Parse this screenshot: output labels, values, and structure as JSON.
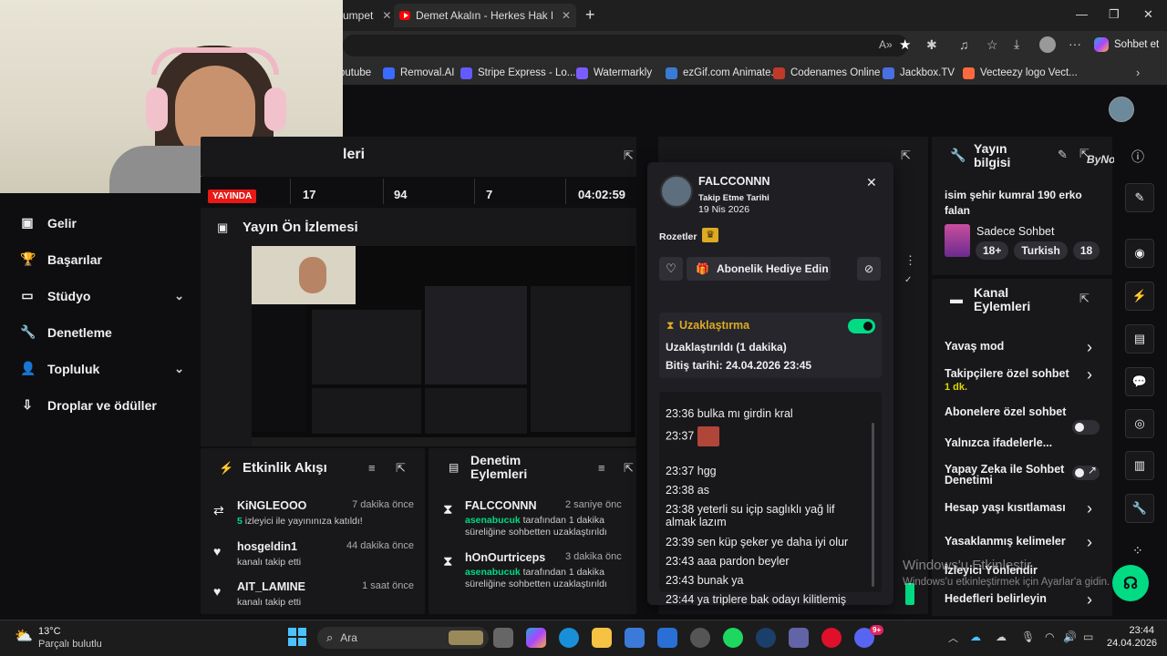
{
  "browser": {
    "tabs": [
      {
        "label": "umpet"
      },
      {
        "label": "Demet Akalın - Herkes Hak Ettiği C"
      }
    ],
    "new_tab": "+",
    "chat_button": "Sohbet et",
    "bookmarks": [
      {
        "label": "outube",
        "color": "#f00"
      },
      {
        "label": "Removal.AI",
        "color": "#3b6bff"
      },
      {
        "label": "Stripe Express - Lo...",
        "color": "#635bff"
      },
      {
        "label": "Watermarkly",
        "color": "#7b5cff"
      },
      {
        "label": "ezGif.com Animate...",
        "color": "#3a7bd5"
      },
      {
        "label": "Codenames Online",
        "color": "#c0392b"
      },
      {
        "label": "Jackbox.TV",
        "color": "#4a6fe0"
      },
      {
        "label": "Vecteezy logo Vect...",
        "color": "#ff6a3d"
      }
    ]
  },
  "sidebar": {
    "items": [
      {
        "label": "Gelir",
        "icon": "wallet-icon"
      },
      {
        "label": "Başarılar",
        "icon": "trophy-icon"
      },
      {
        "label": "Stüdyo",
        "icon": "studio-icon",
        "has_chevron": true
      },
      {
        "label": "Denetleme",
        "icon": "wrench-icon"
      },
      {
        "label": "Topluluk",
        "icon": "people-icon",
        "has_chevron": true
      },
      {
        "label": "Droplar ve ödüller",
        "icon": "drops-icon"
      }
    ]
  },
  "stats": {
    "title_partial": "leri",
    "live": "YAYINDA",
    "viewers": "17",
    "followers": "94",
    "subs": "7",
    "uptime": "04:02:59"
  },
  "preview": {
    "title": "Yayın Ön İzlemesi"
  },
  "activity": {
    "title": "Etkinlik Akışı",
    "items": [
      {
        "name": "KiNGLEOOO",
        "time": "7 dakika önce",
        "highlight": "5",
        "detail": " izleyici ile yayınınıza katıldı!",
        "icon": "raid-icon"
      },
      {
        "name": "hosgeldin1",
        "time": "44 dakika önce",
        "detail": "kanalı takip etti",
        "icon": "heart-icon"
      },
      {
        "name": "AIT_LAMINE",
        "time": "1 saat önce",
        "detail": "kanalı takip etti",
        "icon": "heart-icon"
      }
    ]
  },
  "moderation": {
    "title": "Denetim Eylemleri",
    "items": [
      {
        "name": "FALCCONNN",
        "time": "2 saniye önc",
        "actor": "asenabucuk",
        "detail": " tarafından 1 dakika süreliğine sohbetten uzaklaştırıldı"
      },
      {
        "name": "hOnOurtriceps",
        "time": "3 dakika önc",
        "actor": "asenabucuk",
        "detail": " tarafından 1 dakika süreliğine sohbetten uzaklaştırıldı"
      }
    ]
  },
  "user_card": {
    "username": "FALCCONNN",
    "follow_label": "Takip Etme Tarihi",
    "follow_date": "19 Nis 2026",
    "badges_label": "Rozetler",
    "gift_button": "Abonelik Hediye Edin",
    "timeout": {
      "title": "Uzaklaştırma",
      "status": "Uzaklaştırıldı (1 dakika)",
      "end": "Bitiş tarihi: 24.04.2026 23:45",
      "toggle_on": true
    },
    "chat": [
      {
        "time": "23:36",
        "text": "bulka mı girdin kral"
      },
      {
        "time": "23:37",
        "text": "",
        "emote": true
      },
      {
        "time": "23:37",
        "text": "hgg"
      },
      {
        "time": "23:38",
        "text": "as"
      },
      {
        "time": "23:38",
        "text": "yeterli su içip saglıklı yağ lif almak lazım"
      },
      {
        "time": "23:39",
        "text": "sen küp şeker ye daha iyi olur"
      },
      {
        "time": "23:43",
        "text": "aaa pardon beyler"
      },
      {
        "time": "23:43",
        "text": "bunak ya"
      },
      {
        "time": "23:44",
        "text": "ya triplere bak odayı kilitlemiş"
      }
    ]
  },
  "stream_info": {
    "title": "Yayın bilgisi",
    "description": "isim şehir kumral 190 erko falan",
    "category": "Sadece Sohbet",
    "tags": [
      "18+",
      "Turkish",
      "18"
    ]
  },
  "channel_actions": {
    "title": "Kanal Eylemleri",
    "rows": [
      {
        "label": "Yavaş mod",
        "control": "chevron"
      },
      {
        "label": "Takipçilere özel sohbet",
        "sub": "1 dk.",
        "control": "chevron"
      },
      {
        "label": "Abonelere özel sohbet",
        "control": "toggle"
      },
      {
        "label": "Yalnızca ifadelerle...",
        "control": "toggle"
      },
      {
        "label": "Yapay Zeka ile Sohbet Denetimi",
        "control": "external"
      },
      {
        "label": "Hesap yaşı kısıtlaması",
        "control": "chevron"
      },
      {
        "label": "Yasaklanmış kelimeler",
        "control": "chevron"
      },
      {
        "label": "İzleyici Yönlendir",
        "control": "none"
      },
      {
        "label": "Hedefleri belirleyin",
        "control": "chevron"
      }
    ]
  },
  "watermark": {
    "line1": "Windows'u Etkinleştir",
    "line2": "Windows'u etkinleştirmek için Ayarlar'a gidin."
  },
  "brand": "ByNoGame",
  "taskbar": {
    "weather_temp": "13°C",
    "weather_text": "Parçalı bulutlu",
    "search": "Ara",
    "time": "23:44",
    "date": "24.04.2026",
    "badge": "9+"
  }
}
